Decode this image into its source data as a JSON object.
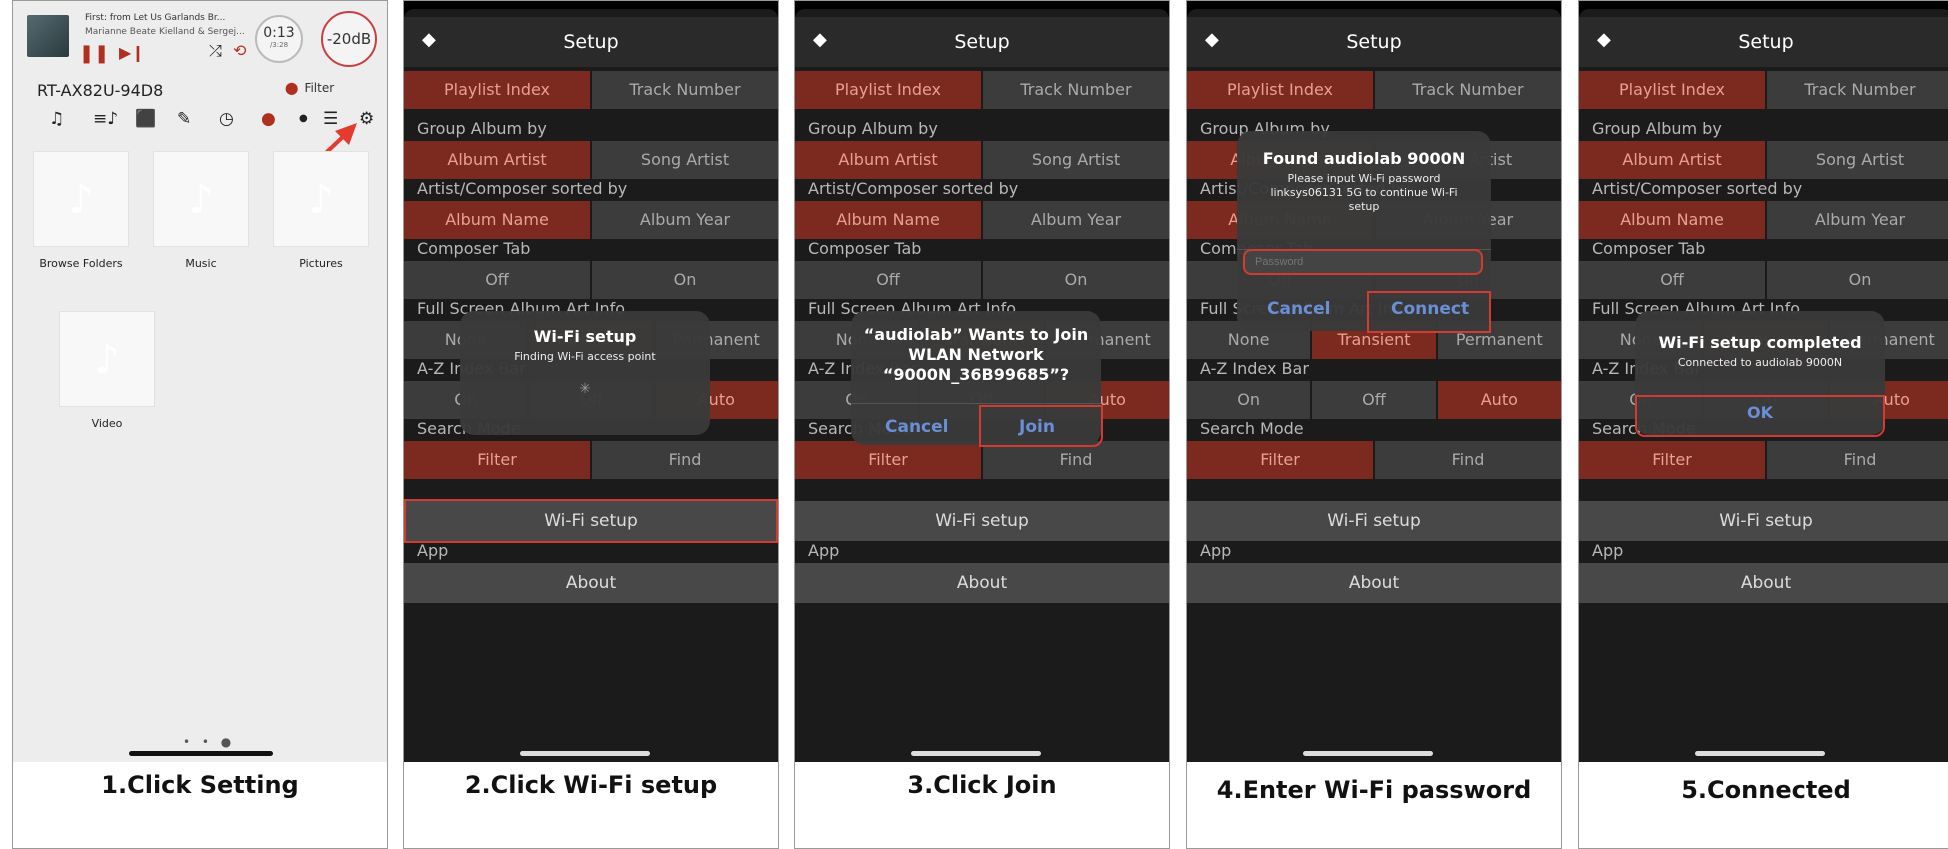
{
  "colors": {
    "accent": "#7c2a20",
    "highlight": "#d23c30"
  },
  "p1": {
    "now_playing_title": "First: from Let Us Garlands Br...",
    "now_playing_artist": "Marianne Beate Kielland & Sergej...",
    "time": "0:13",
    "duration": "/3:28",
    "volume": "-20dB",
    "device": "RT-AX82U-94D8",
    "filter_label": "Filter",
    "tiles": [
      "Browse Folders",
      "Music",
      "Pictures",
      "Video"
    ],
    "caption": "1.Click Setting"
  },
  "setup": {
    "title": "Setup",
    "seg1": [
      "Playlist Index",
      "Track Number"
    ],
    "group_album_label": "Group Album by",
    "group_album": [
      "Album Artist",
      "Song Artist"
    ],
    "sorted_label": "Artist/Composer sorted by",
    "sorted": [
      "Album Name",
      "Album Year"
    ],
    "composer_tab_label": "Composer Tab",
    "composer_tab": [
      "Off",
      "On"
    ],
    "full_screen_label": "Full Screen Album Art Info",
    "full_screen": [
      "None",
      "Transient",
      "Permanent"
    ],
    "az_label": "A-Z Index Bar",
    "az": [
      "On",
      "Off",
      "Auto"
    ],
    "search_label": "Search Mode",
    "search": [
      "Filter",
      "Find"
    ],
    "wifi_button": "Wi-Fi setup",
    "app_label": "App",
    "about_button": "About"
  },
  "p2": {
    "dlg_title": "Wi-Fi setup",
    "dlg_msg": "Finding Wi-Fi access point",
    "caption": "2.Click Wi-Fi setup"
  },
  "p3": {
    "dlg_title": "“audiolab” Wants to Join WLAN Network “9000N_36B99685”?",
    "cancel": "Cancel",
    "join": "Join",
    "caption": "3.Click Join"
  },
  "p4": {
    "dlg_title": "Found audiolab 9000N",
    "dlg_msg": "Please input Wi-Fi password linksys06131 5G to continue Wi-Fi setup",
    "password_placeholder": "Password",
    "cancel": "Cancel",
    "connect": "Connect",
    "caption": "4.Enter Wi-Fi password"
  },
  "p5": {
    "dlg_title": "Wi-Fi setup completed",
    "dlg_msg": "Connected to audiolab 9000N",
    "ok": "OK",
    "caption": "5.Connected"
  }
}
